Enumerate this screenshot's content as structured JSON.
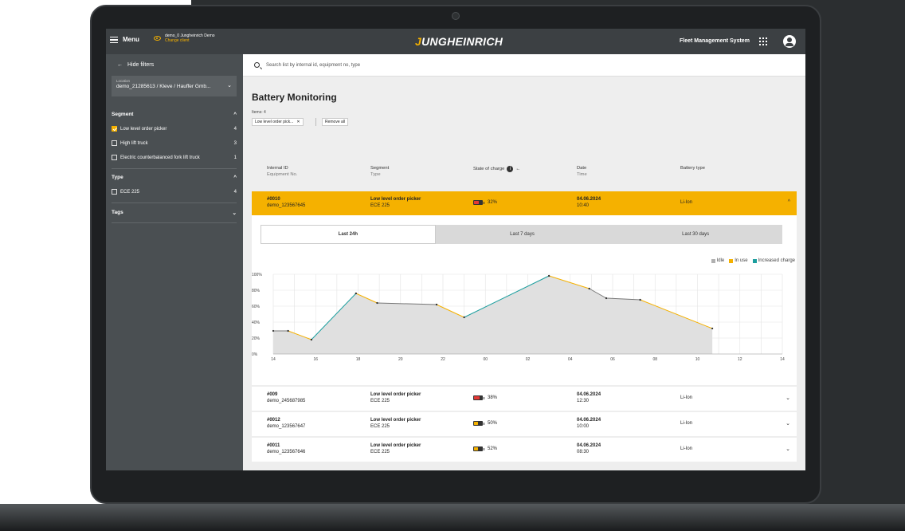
{
  "topbar": {
    "menu_label": "Menu",
    "client_name": "demo_0 Jungheinrich Demo",
    "client_change": "Change client",
    "logo": "JUNGHEINRICH",
    "system_name": "Fleet Management System"
  },
  "sidebar": {
    "hide_filters": "Hide filters",
    "location_label": "Location",
    "location_value": "demo_21285613 / Kleve / Hauffer Gmb...",
    "segment_title": "Segment",
    "segments": [
      {
        "label": "Low level order picker",
        "count": "4",
        "checked": true
      },
      {
        "label": "High lift truck",
        "count": "3",
        "checked": false
      },
      {
        "label": "Electric counterbalanced fork lift truck",
        "count": "1",
        "checked": false
      }
    ],
    "type_title": "Type",
    "types": [
      {
        "label": "ECE 225",
        "count": "4",
        "checked": false
      }
    ],
    "tags_title": "Tags"
  },
  "search": {
    "placeholder": "Search list by internal id, equipment no, type"
  },
  "main": {
    "title": "Battery Monitoring",
    "items_count": "Items: 4",
    "filter_chip": "Low level order pick...",
    "remove_all": "Remove all"
  },
  "table": {
    "headers": {
      "id": "Internal ID",
      "id_sub": "Equipment No.",
      "segment": "Segment",
      "segment_sub": "Type",
      "soc": "State of charge",
      "date": "Date",
      "date_sub": "Time",
      "battery": "Battery type"
    },
    "rows": [
      {
        "id": "#0010",
        "equip": "demo_123567645",
        "segment": "Low level order picker",
        "type": "ECE 225",
        "soc": "32%",
        "soc_value": 32,
        "date": "04.06.2024",
        "time": "10:40",
        "battery": "Li-Ion",
        "expanded": true
      },
      {
        "id": "#009",
        "equip": "demo_245687985",
        "segment": "Low level order picker",
        "type": "ECE 225",
        "soc": "38%",
        "soc_value": 38,
        "date": "04.06.2024",
        "time": "12:30",
        "battery": "Li-Ion",
        "expanded": false
      },
      {
        "id": "#0012",
        "equip": "demo_123567647",
        "segment": "Low level order picker",
        "type": "ECE 225",
        "soc": "50%",
        "soc_value": 50,
        "date": "04.06.2024",
        "time": "10:00",
        "battery": "Li-Ion",
        "expanded": false
      },
      {
        "id": "#0011",
        "equip": "demo_123567646",
        "segment": "Low level order picker",
        "type": "ECE 225",
        "soc": "52%",
        "soc_value": 52,
        "date": "04.06.2024",
        "time": "08:30",
        "battery": "Li-Ion",
        "expanded": false
      }
    ]
  },
  "detail": {
    "tabs": [
      "Last 24h",
      "Last 7 days",
      "Last 30 days"
    ],
    "active_tab": 0,
    "legend": [
      "Idle",
      "In use",
      "Increased charge"
    ]
  },
  "colors": {
    "accent": "#f5b100",
    "idle": "#b0b0b0",
    "in_use": "#f5b100",
    "increased_charge": "#1a9e9e",
    "battery_low": "#e53935",
    "battery_mid": "#f5b100"
  },
  "chart_data": {
    "type": "line",
    "x_ticks": [
      "14",
      "16",
      "18",
      "20",
      "22",
      "00",
      "02",
      "04",
      "06",
      "08",
      "10",
      "12",
      "14"
    ],
    "y_ticks": [
      "0%",
      "20%",
      "40%",
      "60%",
      "80%",
      "100%"
    ],
    "ylim": [
      0,
      100
    ],
    "xlim": [
      14,
      38
    ],
    "grid": true,
    "legend_position": "top-right",
    "series": [
      {
        "name": "Idle",
        "x": [
          14,
          14.7
        ],
        "y": [
          29,
          29
        ]
      },
      {
        "name": "In use",
        "x": [
          14.7,
          15.8
        ],
        "y": [
          29,
          18
        ]
      },
      {
        "name": "Increased charge",
        "x": [
          15.8,
          17.9
        ],
        "y": [
          18,
          76
        ]
      },
      {
        "name": "In use",
        "x": [
          17.9,
          18.9
        ],
        "y": [
          76,
          64
        ]
      },
      {
        "name": "Idle",
        "x": [
          18.9,
          21.7
        ],
        "y": [
          64,
          62
        ]
      },
      {
        "name": "In use",
        "x": [
          21.7,
          23.0
        ],
        "y": [
          62,
          46
        ]
      },
      {
        "name": "Increased charge",
        "x": [
          23.0,
          27.0
        ],
        "y": [
          46,
          98
        ]
      },
      {
        "name": "In use",
        "x": [
          27.0,
          28.9
        ],
        "y": [
          98,
          82
        ]
      },
      {
        "name": "Idle",
        "x": [
          28.9,
          29.7
        ],
        "y": [
          82,
          70
        ]
      },
      {
        "name": "Idle",
        "x": [
          29.7,
          31.3
        ],
        "y": [
          70,
          68
        ]
      },
      {
        "name": "In use",
        "x": [
          31.3,
          34.7
        ],
        "y": [
          68,
          32
        ]
      }
    ]
  }
}
